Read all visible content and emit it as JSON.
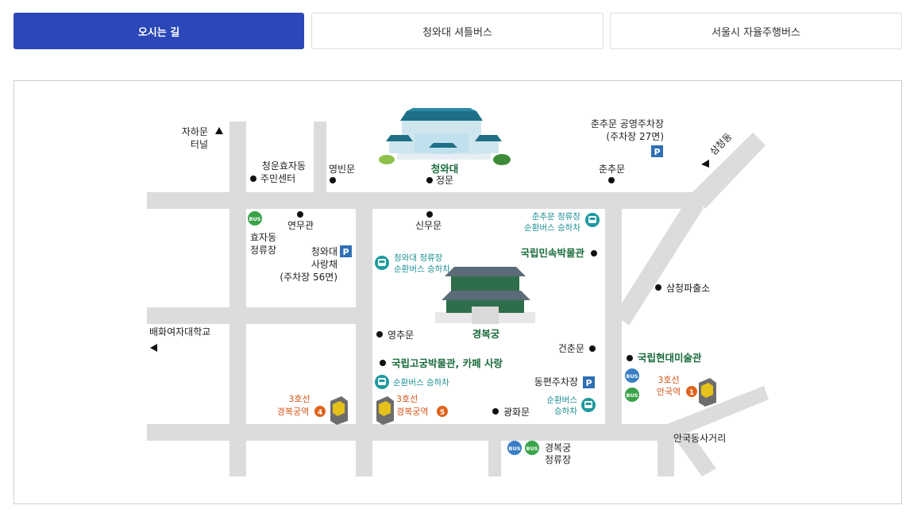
{
  "tabs": [
    {
      "label": "오시는 길",
      "active": true
    },
    {
      "label": "청와대 셔틀버스",
      "active": false
    },
    {
      "label": "서울시 자율주행버스",
      "active": false
    }
  ],
  "map": {
    "places": {
      "jahamun_1": "자하문",
      "jahamun_2": "터널",
      "cheongun_1": "청운효자동",
      "cheongun_2": "주민센터",
      "yeongbinmun": "영빈문",
      "cheongwadae": "청와대",
      "jeongmun": "정문",
      "chunchumun_parking_1": "춘추문 공영주차장",
      "chunchumun_parking_2": "(주차장 27면)",
      "chunchumun": "춘추문",
      "samcheongdong": "삼청동",
      "yeonmugwan": "연무관",
      "hyoja_stop_1": "효자동",
      "hyoja_stop_2": "정류장",
      "sarangchae_1": "청와대",
      "sarangchae_2": "사랑채",
      "sarangchae_3": "(주차장 56면)",
      "sinmumun": "신무문",
      "chunchumun_stop_1": "춘추문 정류장",
      "chunchumun_stop_2": "순환버스 승하차",
      "cheongwadae_stop_1": "청와대 정류장",
      "cheongwadae_stop_2": "순환버스 승하차",
      "folk_museum": "국립민속박물관",
      "samcheong_police": "삼청파출소",
      "baehwa_univ": "배화여자대학교",
      "yeongchumun": "영추문",
      "gyeongbokgung": "경복궁",
      "geonchunmun": "건춘문",
      "mmca": "국립현대미술관",
      "palace_museum": "국립고궁박물관, 카페 사랑",
      "circular_bus": "순환버스 승하차",
      "east_parking": "동편주차장",
      "anguk_line": "3호선",
      "anguk_station": "안국역",
      "gb_line_4": "3호선",
      "gb_station_4": "경복궁역",
      "gb_line_5": "3호선",
      "gb_station_5": "경복궁역",
      "circular_bus_2_1": "순환버스",
      "circular_bus_2_2": "승하차",
      "gwanghwamun": "광화문",
      "anguk_intersection": "안국동사거리",
      "gb_stop_1": "경복궁",
      "gb_stop_2": "정류장"
    },
    "badges": {
      "bus": "BUS",
      "parking": "P",
      "exit1": "1",
      "exit4": "4",
      "exit5": "5"
    },
    "colors": {
      "road": "#dcdcdc",
      "green_text": "#1a6b3c",
      "teal_text": "#1e8f94",
      "orange_text": "#d4561a",
      "parking_blue": "#2f6fb5",
      "bus_green": "#3aa34a",
      "bus_blue": "#3a7fc4",
      "exit_orange": "#e0621c"
    }
  }
}
